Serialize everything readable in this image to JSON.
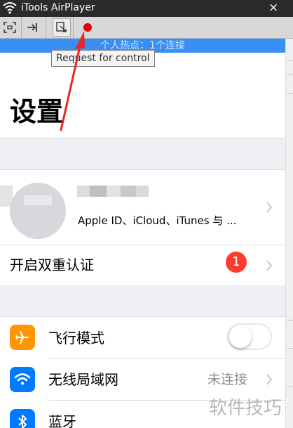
{
  "window": {
    "title": "iTools AirPlayer",
    "close_glyph": "×"
  },
  "toolbar": {
    "buttons": [
      {
        "icon": "fullscreen-icon"
      },
      {
        "icon": "pin-icon"
      },
      {
        "icon": "screenshot-icon"
      },
      {
        "icon": "record-icon"
      }
    ],
    "tooltip": "Request for control"
  },
  "status": {
    "hotspot_text": "个人热点：1个连接"
  },
  "settings": {
    "title": "设置",
    "apple_id_subtitle": "Apple ID、iCloud、iTunes 与 ...",
    "two_factor_label": "开启双重认证",
    "two_factor_badge": "1",
    "airplane_mode_label": "飞行模式",
    "airplane_mode_on": false,
    "wlan_label": "无线局域网",
    "wlan_value": "未连接",
    "bluetooth_label": "蓝牙"
  },
  "watermark": "软件技巧",
  "colors": {
    "accent_blue": "#3a8ff5",
    "badge_red": "#ff3b30",
    "airplane_orange": "#ff9500",
    "wifi_blue": "#007aff",
    "record_red": "#e00000",
    "arrow_red": "#e8262b"
  }
}
